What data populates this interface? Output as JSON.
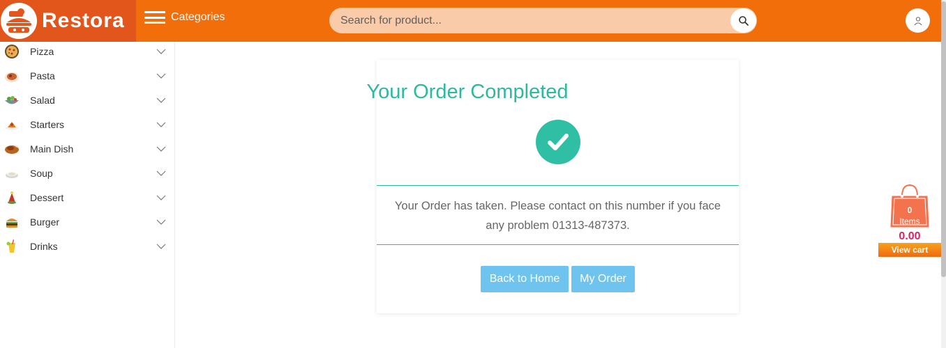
{
  "brand": {
    "name": "Restora"
  },
  "header": {
    "categories_label": "Categories",
    "search_placeholder": "Search for product...",
    "search_icon": "magnifier-icon",
    "user_icon": "user-icon",
    "accent_color": "#f26e0a"
  },
  "sidebar": {
    "items": [
      {
        "label": "Pizza",
        "icon": "pizza-icon"
      },
      {
        "label": "Pasta",
        "icon": "pasta-icon"
      },
      {
        "label": "Salad",
        "icon": "salad-icon"
      },
      {
        "label": "Starters",
        "icon": "starters-icon"
      },
      {
        "label": "Main Dish",
        "icon": "main-dish-icon"
      },
      {
        "label": "Soup",
        "icon": "soup-icon"
      },
      {
        "label": "Dessert",
        "icon": "dessert-icon"
      },
      {
        "label": "Burger",
        "icon": "burger-icon"
      },
      {
        "label": "Drinks",
        "icon": "drinks-icon"
      }
    ]
  },
  "order": {
    "title": "Your Order Completed",
    "message": "Your Order has taken. Please contact on this number if you face any problem 01313-487373.",
    "back_home_label": "Back to Home",
    "my_order_label": "My Order",
    "success_color": "#2fbfa5"
  },
  "cart": {
    "count": "0",
    "items_label": "Items",
    "total": "0.00",
    "view_cart_label": "View cart"
  }
}
